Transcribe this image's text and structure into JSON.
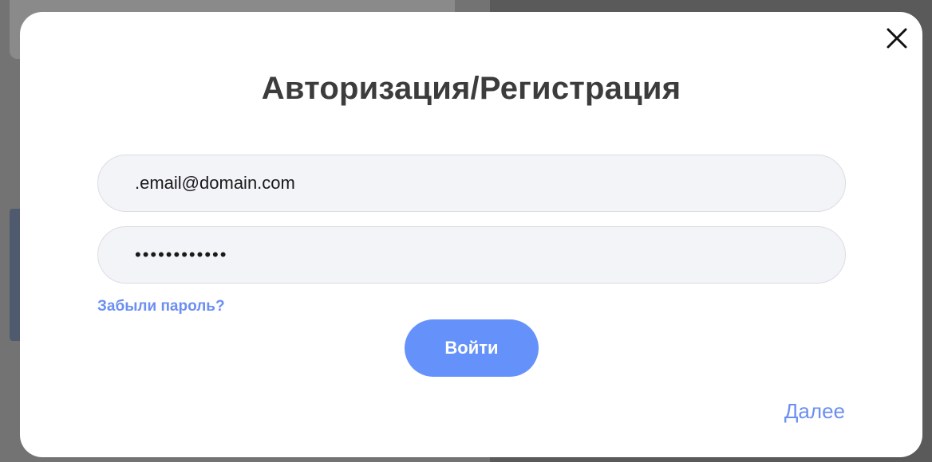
{
  "modal": {
    "title": "Авторизация/Регистрация",
    "close_icon": "close-icon",
    "email": {
      "value": ".email@domain.com",
      "placeholder": ""
    },
    "password": {
      "value": "••••••••••••",
      "placeholder": ""
    },
    "forgot_password_label": "Забыли пароль?",
    "login_button_label": "Войти",
    "next_label": "Далее"
  },
  "colors": {
    "accent": "#6592fa",
    "link": "#6b8ff2",
    "title": "#3c3c3c",
    "field_bg": "#f3f4f8"
  }
}
